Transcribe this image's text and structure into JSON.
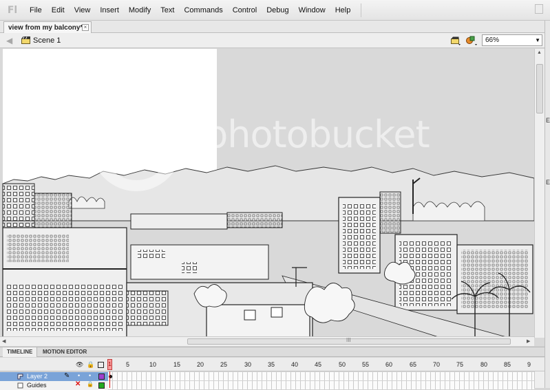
{
  "app": {
    "logo": "Fl"
  },
  "menu": [
    "File",
    "Edit",
    "View",
    "Insert",
    "Modify",
    "Text",
    "Commands",
    "Control",
    "Debug",
    "Window",
    "Help"
  ],
  "document": {
    "tab_title": "view from my balcony*",
    "close_glyph": "×"
  },
  "editbar": {
    "scene": "Scene 1",
    "zoom": "66%",
    "back_icon": "back-arrow-icon"
  },
  "right_panel": {
    "tags": [
      "E",
      "E"
    ]
  },
  "stage": {
    "watermark_text": "photobucket",
    "scroll_grip": "III"
  },
  "timeline": {
    "tabs": [
      "TIMELINE",
      "MOTION EDITOR"
    ],
    "frame_numbers": [
      "1",
      "5",
      "10",
      "15",
      "20",
      "25",
      "30",
      "35",
      "40",
      "45",
      "50",
      "55",
      "60",
      "65",
      "70",
      "75",
      "80",
      "85",
      "9"
    ],
    "layers": [
      {
        "name": "Layer 2",
        "selected": true,
        "color": "#a040d0"
      },
      {
        "name": "Guides",
        "selected": false,
        "color": "#22aa22"
      }
    ]
  }
}
